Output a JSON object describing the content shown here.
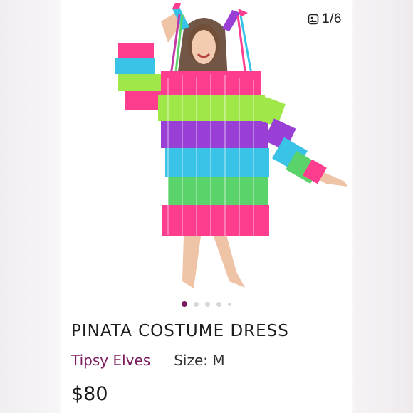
{
  "listing": {
    "image_counter": "1/6",
    "carousel": {
      "total_dots": 5,
      "active_index": 0
    },
    "title": "PINATA COSTUME DRESS",
    "brand": "Tipsy Elves",
    "size": "Size: M",
    "price": "$80"
  },
  "colors": {
    "brand": "#7b1b5e",
    "active_dot": "#7a1a5a"
  }
}
